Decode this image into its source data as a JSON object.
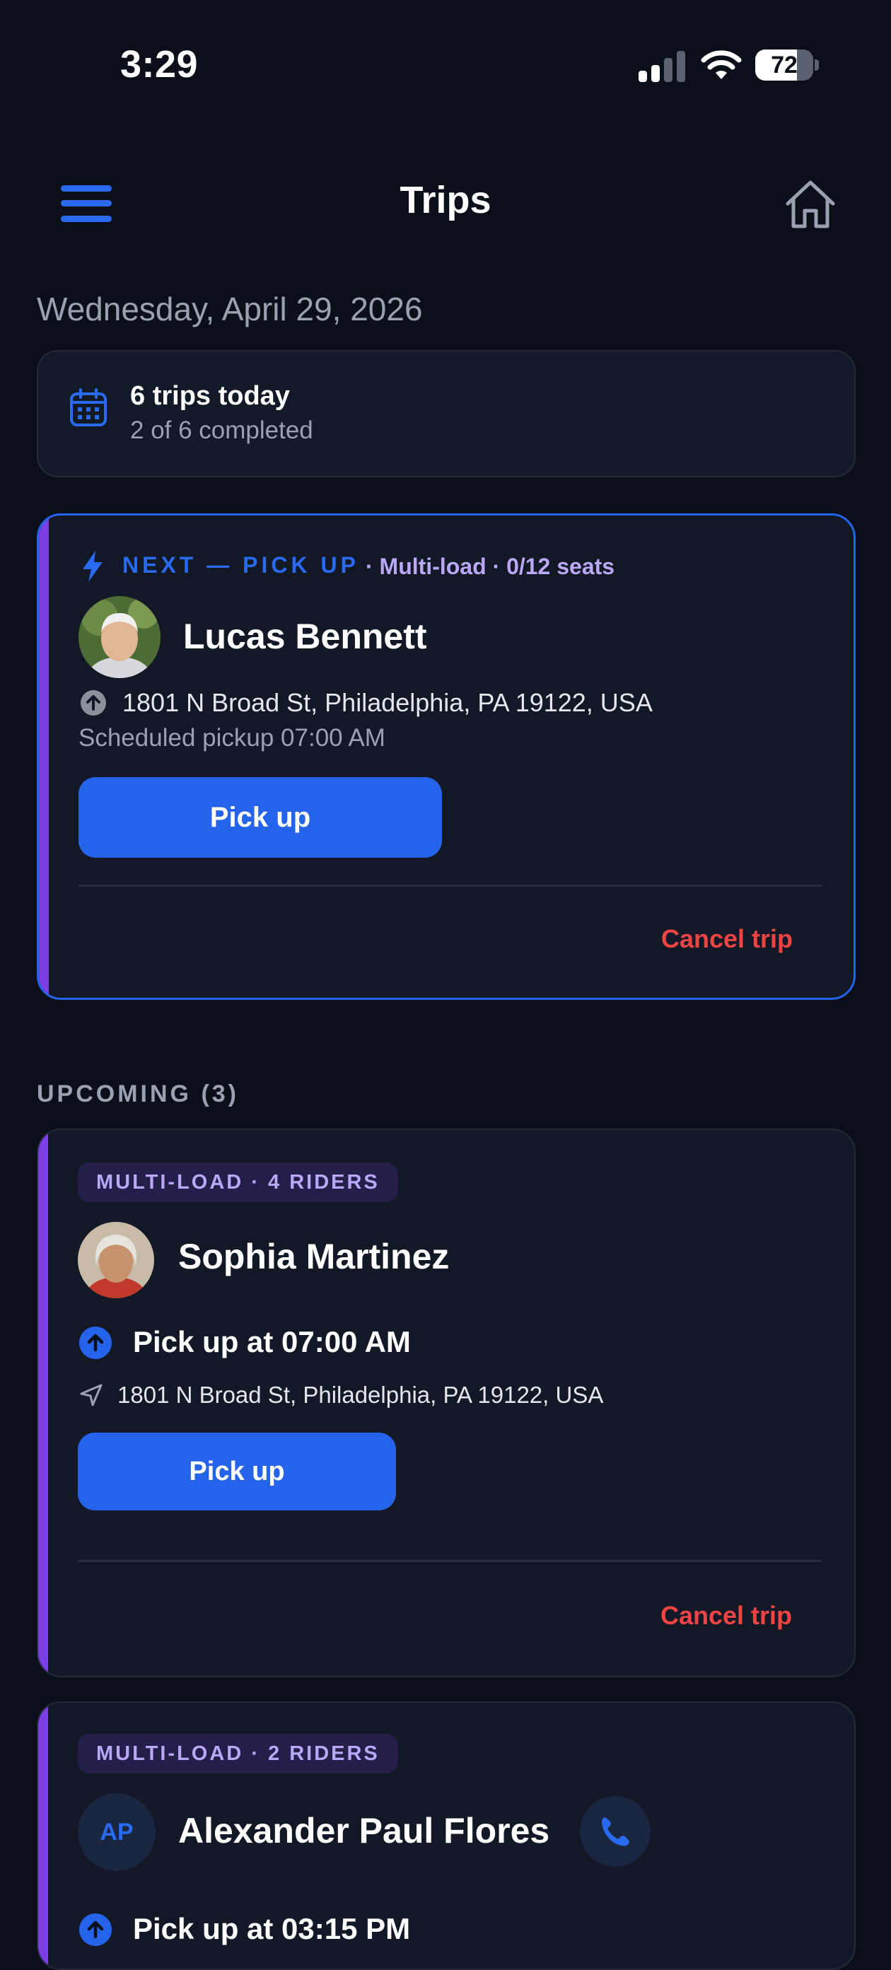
{
  "status_bar": {
    "time": "3:29",
    "battery": "72",
    "battery_level": 0.72
  },
  "header": {
    "title": "Trips",
    "menu_icon": "hamburger-icon",
    "home_icon": "home-icon"
  },
  "date": "Wednesday, April 29, 2026",
  "summary": {
    "title": "6 trips today",
    "subtitle": "2 of 6 completed",
    "icon": "calendar-icon"
  },
  "next_trip": {
    "label": "NEXT — PICK UP",
    "meta": "· Multi-load · 0/12 seats",
    "name": "Lucas Bennett",
    "address": "1801 N Broad St, Philadelphia, PA 19122, USA",
    "scheduled": "Scheduled pickup 07:00 AM",
    "button": "Pick up",
    "cancel": "Cancel trip"
  },
  "upcoming": {
    "label": "UPCOMING (3)",
    "trips": [
      {
        "badge": "MULTI-LOAD · 4 RIDERS",
        "name": "Sophia Martinez",
        "pickup": "Pick up at 07:00 AM",
        "address": "1801 N Broad St, Philadelphia, PA 19122, USA",
        "button": "Pick up",
        "cancel": "Cancel trip"
      },
      {
        "badge": "MULTI-LOAD · 2 RIDERS",
        "initials": "AP",
        "name": "Alexander Paul Flores",
        "pickup": "Pick up at 03:15 PM"
      }
    ]
  },
  "colors": {
    "background": "#0b0f19",
    "card": "#121826",
    "accent_blue": "#2563eb",
    "accent_purple": "#7b3fe4",
    "danger": "#ef4444"
  }
}
